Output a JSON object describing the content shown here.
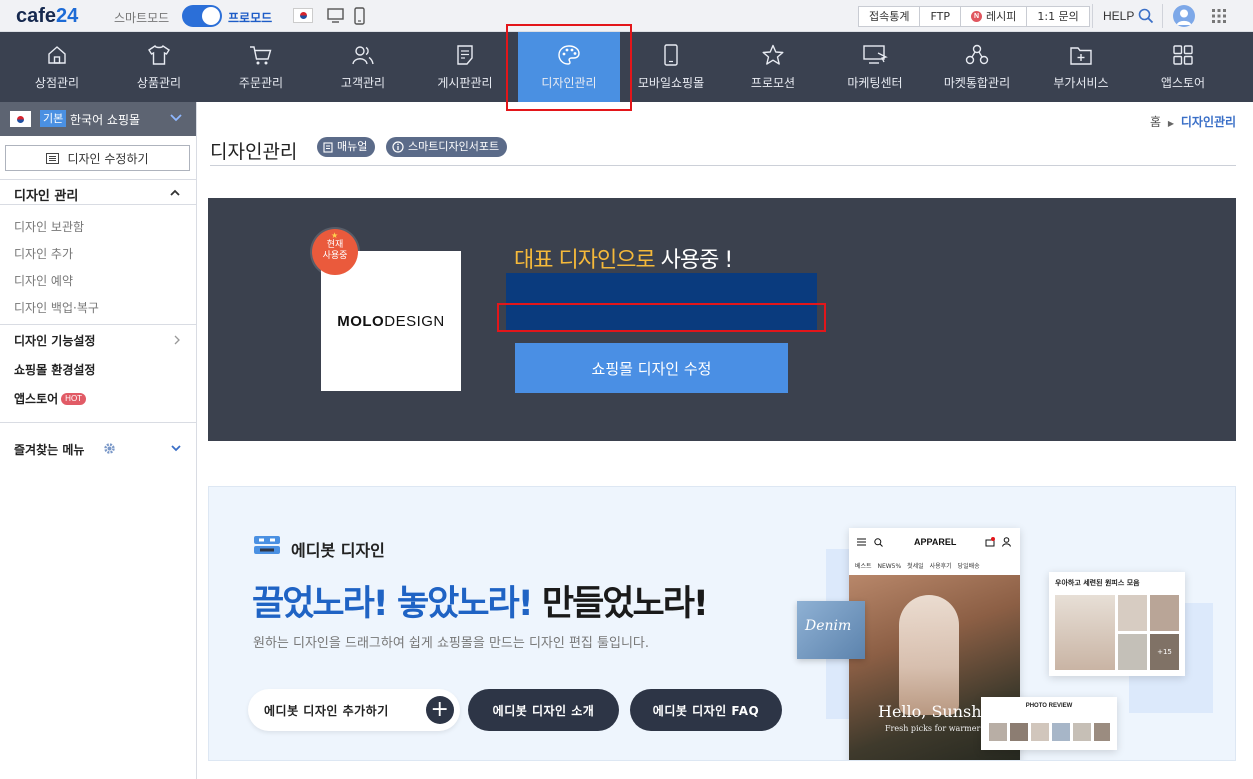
{
  "topbar": {
    "logo_main": "cafe",
    "logo_accent": "24",
    "smart_mode_label": "스마트모드",
    "pro_mode_label": "프로모드",
    "quicklinks": [
      "접속통계",
      "FTP",
      "레시피",
      "1:1 문의"
    ],
    "recipe_icon_letter": "N",
    "help_label": "HELP",
    "icons": [
      "kr-flag-icon",
      "pc-icon",
      "mobile-icon",
      "search-icon",
      "user-icon",
      "apps-grid-icon"
    ]
  },
  "nav": {
    "items": [
      {
        "label": "상점관리",
        "icon": "store-icon"
      },
      {
        "label": "상품관리",
        "icon": "shirt-icon"
      },
      {
        "label": "주문관리",
        "icon": "cart-icon"
      },
      {
        "label": "고객관리",
        "icon": "customers-icon"
      },
      {
        "label": "게시판관리",
        "icon": "board-icon"
      },
      {
        "label": "디자인관리",
        "icon": "palette-icon"
      },
      {
        "label": "모바일쇼핑몰",
        "icon": "mobile-icon"
      },
      {
        "label": "프로모션",
        "icon": "star-icon"
      },
      {
        "label": "마케팅센터",
        "icon": "marketing-icon"
      },
      {
        "label": "마켓통합관리",
        "icon": "market-icon"
      },
      {
        "label": "부가서비스",
        "icon": "addon-folder-icon"
      },
      {
        "label": "앱스토어",
        "icon": "appstore-icon"
      }
    ],
    "active_index": 5,
    "active_color": "#4a90e2",
    "bar_color": "#3a4150"
  },
  "sidebar": {
    "store_badge": "기본",
    "store_name": "한국어 쇼핑몰",
    "edit_button": "디자인 수정하기",
    "section_title": "디자인 관리",
    "sub_items": [
      "디자인 보관함",
      "디자인 추가",
      "디자인 예약",
      "디자인 백업·복구"
    ],
    "main_items": [
      "디자인 기능설정",
      "쇼핑몰 환경설정",
      "앱스토어"
    ],
    "hot_badge": "HOT",
    "favorites_label": "즐겨찾는 메뉴"
  },
  "content": {
    "breadcrumb_home": "홈",
    "breadcrumb_current": "디자인관리",
    "page_title": "디자인관리",
    "manual_pill": "매뉴얼",
    "support_pill": "스마트디자인서포트",
    "current_design": {
      "in_use_badge_line1": "현재",
      "in_use_badge_line2": "사용중",
      "thumb_logo_bold": "MOLO",
      "thumb_logo_rest": "DESIGN",
      "using_highlight": "대표 디자인으로",
      "using_rest": " 사용중 !",
      "edit_button": "쇼핑몰 디자인 수정"
    },
    "editorbot": {
      "name": "에디봇 디자인",
      "headline_part1": "끌었노라! 놓았노라!",
      "headline_part2": " 만들었노라!",
      "description": "원하는 디자인을 드래그하여 쉽게 쇼핑몰을 만드는 디자인 편집 툴입니다.",
      "add_button": "에디봇 디자인 추가하기",
      "intro_button": "에디봇 디자인 소개",
      "faq_button": "에디봇 디자인 FAQ",
      "mockup": {
        "phone_title": "APPAREL",
        "phone_tabs": "베스트 NEW5% 첫세일 사용후기 당일배송",
        "hello_text": "Hello, Sunshine",
        "fresh_text": "Fresh picks for warmer days",
        "denim_text": "Denim",
        "card_title": "우아하고 세련된 원피스 모음",
        "card_more": "+15",
        "review_title": "PHOTO REVIEW"
      }
    }
  },
  "colors": {
    "highlight_box": "#e3161a",
    "design_name_bar": "#0a3b7e",
    "panel_bg": "#3b414e",
    "accent_orange": "#f5b93a"
  }
}
